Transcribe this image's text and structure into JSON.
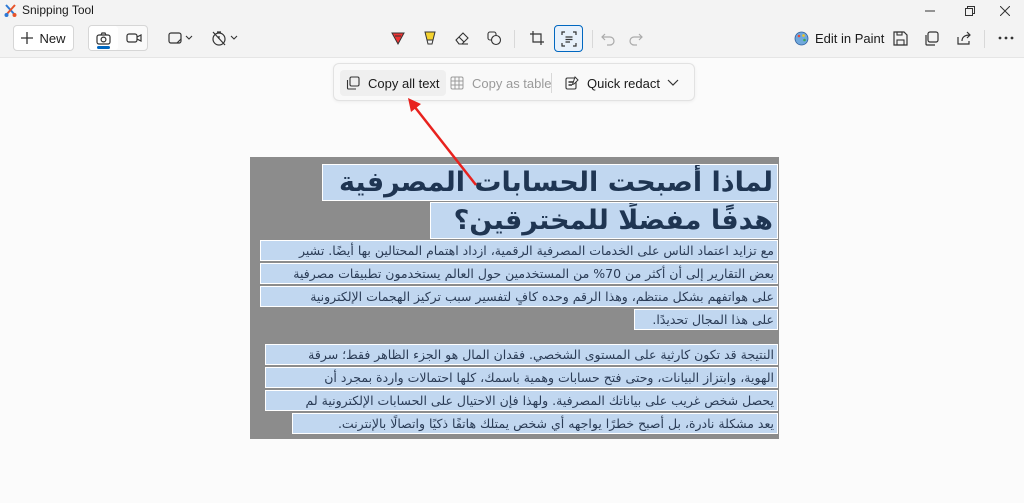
{
  "window": {
    "title": "Snipping Tool",
    "icons": [
      "snipping-tool-logo",
      "minimize-icon",
      "maximize-icon",
      "close-icon"
    ]
  },
  "toolbar": {
    "new_label": "New",
    "edit_in_paint_label": "Edit in Paint",
    "icons": [
      "plus-icon",
      "camera-icon",
      "video-icon",
      "snip-shape-icon",
      "no-timer-icon",
      "ballpoint-pen-icon",
      "highlighter-icon",
      "eraser-icon",
      "shapes-icon",
      "crop-icon",
      "text-actions-icon",
      "undo-icon",
      "redo-icon",
      "paint-icon",
      "save-icon",
      "copy-icon",
      "share-icon",
      "more-icon"
    ],
    "accent": "#0067c0"
  },
  "text_actions": {
    "copy_all_text": "Copy all text",
    "copy_as_table": "Copy as table",
    "quick_redact": "Quick redact"
  },
  "document": {
    "heading_lines": [
      "لماذا أصبحت الحسابات المصرفية",
      "هدفًا مفضلًا للمخترقين؟"
    ],
    "paragraph1_lines": [
      "مع تزايد اعتماد الناس على الخدمات المصرفية الرقمية، ازداد اهتمام المحتالين بها أيضًا. تشير",
      "بعض التقارير إلى أن أكثر من 70% من المستخدمين حول العالم يستخدمون تطبيقات مصرفية",
      "على هواتفهم بشكل منتظم، وهذا الرقم وحده كافٍ لتفسير سبب تركيز الهجمات الإلكترونية",
      "على هذا المجال تحديدًا."
    ],
    "paragraph2_lines": [
      "النتيجة قد تكون كارثية على المستوى الشخصي. فقدان المال هو الجزء الظاهر فقط؛ سرقة",
      "الهوية، وابتزاز البيانات، وحتى فتح حسابات وهمية باسمك، كلها احتمالات واردة بمجرد أن",
      "يحصل شخص غريب على بياناتك المصرفية. ولهذا فإن الاحتيال على الحسابات الإلكترونية لم",
      "يعد مشكلة نادرة، بل أصبح خطرًا يواجهه أي شخص يمتلك هاتفًا ذكيًا واتصالًا بالإنترنت."
    ],
    "highlight_color": "#c1d7f0",
    "background_color": "#8c8c8c"
  },
  "annotation": {
    "arrow_color": "#e8221e"
  }
}
